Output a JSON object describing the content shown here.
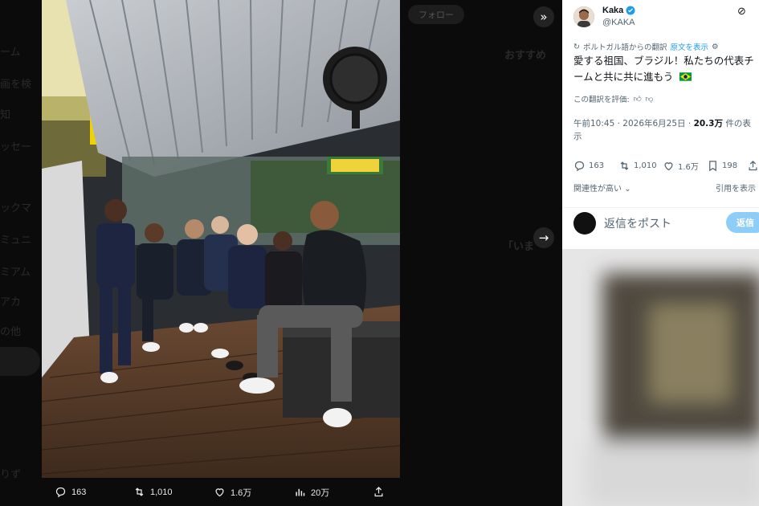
{
  "viewer": {
    "photo_alt_subjects": "group-photo",
    "next_icon": "arrow-right-icon",
    "collapse_icon": "double-chevron-right-icon",
    "bottom_actions": [
      {
        "icon": "reply-icon",
        "count": "163"
      },
      {
        "icon": "retweet-icon",
        "count": "1,010"
      },
      {
        "icon": "like-icon",
        "count": "1.6万"
      },
      {
        "icon": "views-icon",
        "count": "20万"
      },
      {
        "icon": "share-icon",
        "count": ""
      }
    ]
  },
  "tweet": {
    "display_name": "Kaka",
    "handle": "@KAKA",
    "translation_label": "ポルトガル語からの翻訳",
    "original_link": "原文を表示",
    "text_line1": "愛する祖国、ブラジル！私たちの代表チ",
    "text_line2": "ームと共に共に進もう",
    "rate_label": "この翻訳を評価:",
    "timestamp": "午前10:45 · 2026年6月25日 · ",
    "views_bold": "20.3万",
    "views_suffix": " 件の表",
    "views_line2": "示",
    "stats": [
      {
        "icon": "reply-icon",
        "count": "163"
      },
      {
        "icon": "retweet-icon",
        "count": "1,010"
      },
      {
        "icon": "like-icon",
        "count": "1.6万"
      },
      {
        "icon": "bookmark-icon",
        "count": "198"
      },
      {
        "icon": "share-icon",
        "count": ""
      }
    ],
    "related_label": "関連性が高い",
    "quote_label": "引用を表示",
    "reply_placeholder": "返信をポスト",
    "reply_button": "返信"
  },
  "colors": {
    "accent": "#1d9bf0",
    "reply_button": "#8ecdf8",
    "text_primary": "#0f1419",
    "text_secondary": "#536471"
  }
}
